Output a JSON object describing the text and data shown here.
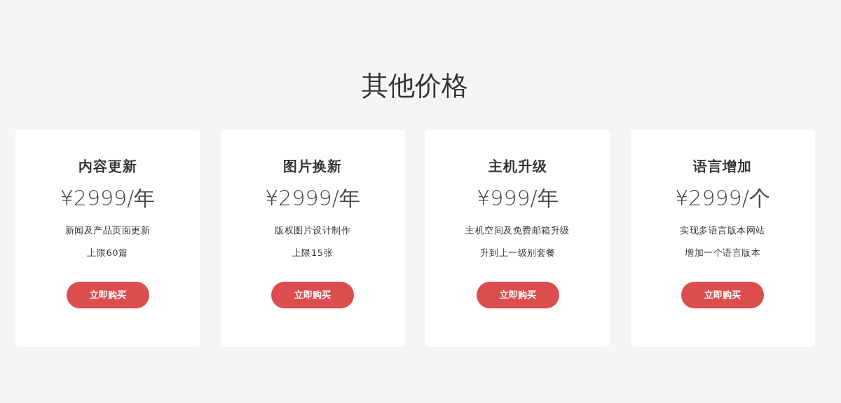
{
  "title": "其他价格",
  "plans": [
    {
      "name": "内容更新",
      "price": "¥2999/年",
      "lines": [
        "新闻及产品页面更新",
        "上限60篇"
      ],
      "button": "立即购买"
    },
    {
      "name": "图片换新",
      "price": "¥2999/年",
      "lines": [
        "版权图片设计制作",
        "上限15张"
      ],
      "button": "立即购买"
    },
    {
      "name": "主机升级",
      "price": "¥999/年",
      "lines": [
        "主机空间及免费邮箱升级",
        "升到上一级别套餐"
      ],
      "button": "立即购买"
    },
    {
      "name": "语言增加",
      "price": "¥2999/个",
      "lines": [
        "实现多语言版本网站",
        "增加一个语言版本"
      ],
      "button": "立即购买"
    }
  ]
}
